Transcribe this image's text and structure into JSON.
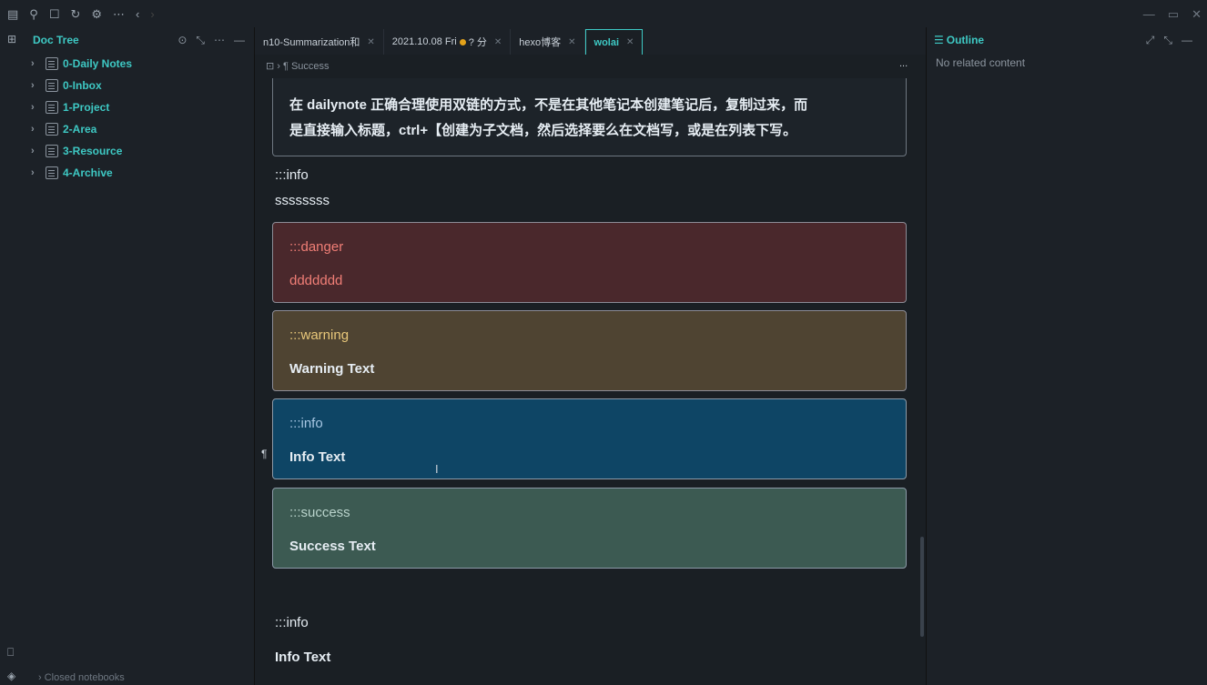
{
  "window": {
    "minimize": "—",
    "maximize": "▭",
    "close": "✕"
  },
  "toolbar_icons": [
    "sidebar-icon",
    "search-icon",
    "square-icon",
    "sync-icon",
    "gear-icon",
    "more-icon",
    "back-icon",
    "forward-icon"
  ],
  "doc_tree": {
    "title": "Doc Tree",
    "items": [
      "0-Daily Notes",
      "0-Inbox",
      "1-Project",
      "2-Area",
      "3-Resource",
      "4-Archive"
    ],
    "closed": "Closed notebooks"
  },
  "tabs": [
    {
      "label": "n10-Summarization和"
    },
    {
      "label": "2021.10.08 Fri",
      "suffix": "? 分"
    },
    {
      "label": "hexo博客"
    },
    {
      "label": "wolai",
      "active": true
    }
  ],
  "breadcrumb": {
    "label": "¶ Success",
    "more": "..."
  },
  "content": {
    "quote_line1": "在 dailynote 正确合理使用双链的方式，不是在其他笔记本创建笔记后，复制过来，而",
    "quote_line2": "是直接输入标题，ctrl+【创建为子文档，然后选择要么在文档写，或是在列表下写。",
    "info_plain_label": ":::info",
    "info_plain_text": "ssssssss",
    "danger_label": ":::danger",
    "danger_text": "ddddddd",
    "warning_label": ":::warning",
    "warning_text": "Warning Text",
    "info_label": ":::info",
    "info_text": "Info Text",
    "success_label": ":::success",
    "success_text": "Success Text",
    "info2_label": ":::info",
    "info2_text": "Info Text"
  },
  "outline": {
    "title": "Outline",
    "empty": "No related content"
  }
}
